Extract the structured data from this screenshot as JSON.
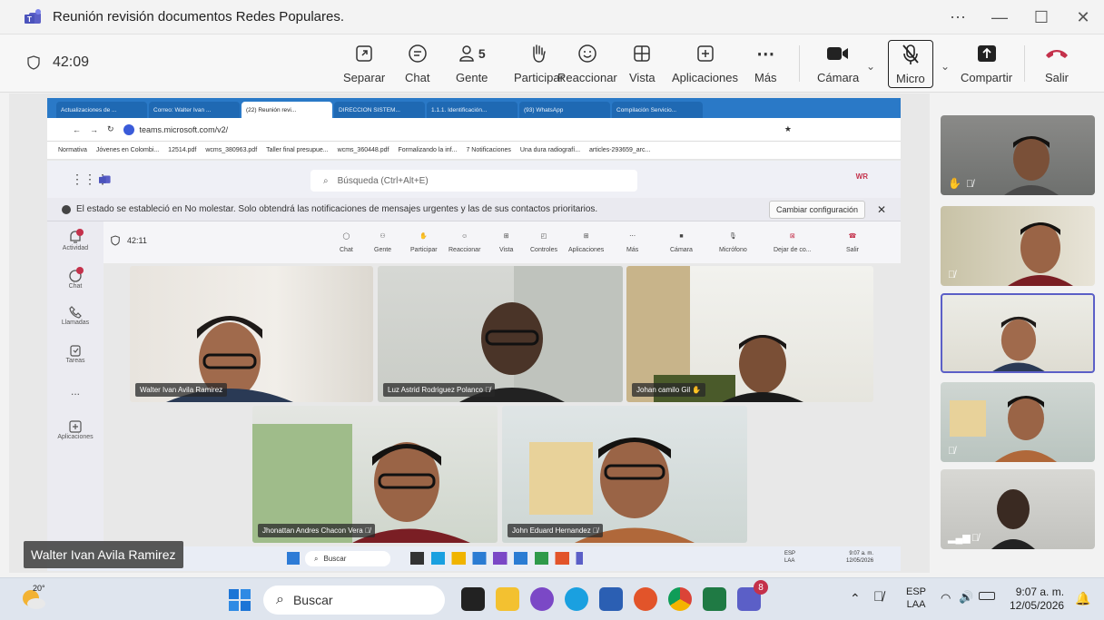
{
  "window": {
    "title": "Reunión revisión documentos Redes Populares."
  },
  "toolbar": {
    "timer": "42:09",
    "separar": "Separar",
    "chat": "Chat",
    "gente": "Gente",
    "gente_count": "5",
    "participar": "Participar",
    "reaccionar": "Reaccionar",
    "vista": "Vista",
    "aplicaciones": "Aplicaciones",
    "mas": "Más",
    "camara": "Cámara",
    "micro": "Micro",
    "compartir": "Compartir",
    "salir": "Salir"
  },
  "browser": {
    "tabs": [
      "Actualizaciones de ...",
      "Correo: Walter Ivan ...",
      "(22) Reunión revi...",
      "DIRECCION SISTEM...",
      "1.1.1. Identificación...",
      "(93) WhatsApp",
      "Compilación Servicio..."
    ],
    "url": "teams.microsoft.com/v2/",
    "bookmarks": [
      "Normativa",
      "Jóvenes en Colombi...",
      "12514.pdf",
      "wcms_380963.pdf",
      "Taller final presupue...",
      "wcms_360448.pdf",
      "Formalizando la inf...",
      "7 Notificaciones",
      "Una dura radiografí...",
      "articles-293659_arc..."
    ]
  },
  "inner": {
    "search_placeholder": "Búsqueda (Ctrl+Alt+E)",
    "avatar_initials": "WR",
    "notice": "El estado se estableció en No molestar. Solo obtendrá las notificaciones de mensajes urgentes y las de sus contactos prioritarios.",
    "notice_button": "Cambiar configuración",
    "timer": "42:11",
    "rail": [
      {
        "label": "Actividad",
        "badge": "14"
      },
      {
        "label": "Chat",
        "badge": "3"
      },
      {
        "label": "Llamadas"
      },
      {
        "label": "Tareas"
      },
      {
        "label": "..."
      },
      {
        "label": "Aplicaciones"
      }
    ],
    "bar": {
      "chat": "Chat",
      "gente": "Gente",
      "gente_count": "5",
      "participar": "Participar",
      "reaccionar": "Reaccionar",
      "vista": "Vista",
      "controles": "Controles",
      "aplicaciones": "Aplicaciones",
      "mas": "Más",
      "camara": "Cámara",
      "microfono": "Micrófono",
      "dejar": "Dejar de co...",
      "salir": "Salir"
    },
    "participants": [
      "Walter Ivan Avila Ramirez",
      "Luz Astrid Rodriguez Polanco",
      "Johan camilo Gil",
      "Jhonattan Andres Chacon Vera",
      "John Eduard Hernandez"
    ],
    "taskbar": {
      "search": "Buscar",
      "lang": "ESP",
      "lang2": "LAA",
      "time": "9:07 a. m.",
      "date": "12/05/2026"
    }
  },
  "name_tooltip": "Walter Ivan Avila Ramirez",
  "taskbar": {
    "weather": "20°",
    "search": "Buscar",
    "lang": "ESP",
    "lang2": "LAA",
    "time": "9:07 a. m.",
    "date": "12/05/2026",
    "teams_badge": "8"
  },
  "colors": {
    "accent": "#5b5fc7",
    "leave": "#c4314b",
    "tab_blue": "#2a79c7"
  }
}
